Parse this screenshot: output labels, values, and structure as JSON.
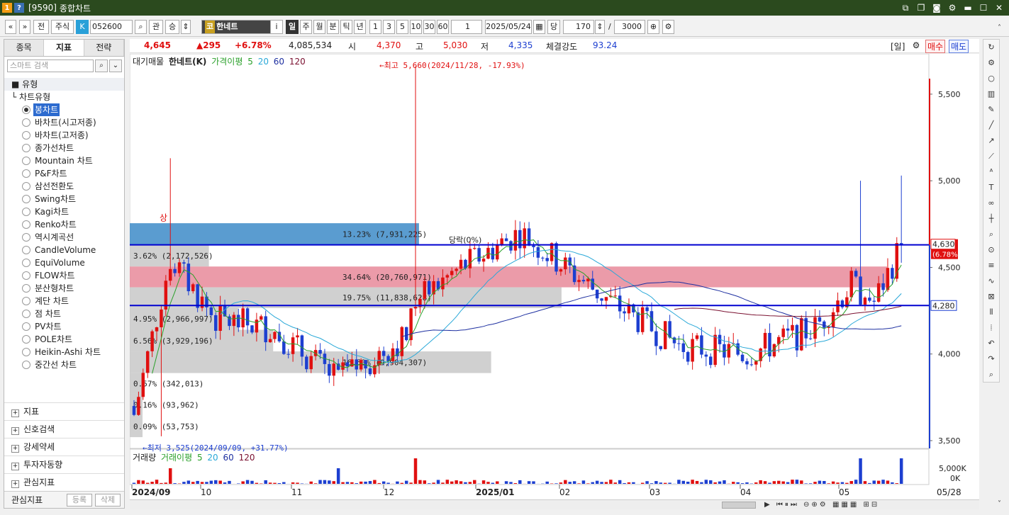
{
  "window": {
    "code": "[9590]",
    "title": "종합차트",
    "icons": [
      "help-icon",
      "menu-icon"
    ]
  },
  "toolbar": {
    "nav": [
      "«",
      "»"
    ],
    "jeon": "전",
    "market": "주식",
    "k_label": "K",
    "code": "052600",
    "gwan": "관",
    "seung": "승",
    "go_badge": "코",
    "stock_name": "한네트",
    "i_label": "i",
    "periods": [
      "일",
      "주",
      "월",
      "분",
      "틱",
      "년"
    ],
    "active_period": "일",
    "minutes": [
      "1",
      "3",
      "5",
      "10",
      "30",
      "60"
    ],
    "count": "1",
    "date": "2025/05/24",
    "dang": "당",
    "bars": "170",
    "slash": "/",
    "total": "3000"
  },
  "panel": {
    "tabs": [
      "종목",
      "지표",
      "전략"
    ],
    "active_tab": "지표",
    "search_placeholder": "스마트 검색",
    "category": "유형",
    "subcategory": "차트유형",
    "items": [
      "봉차트",
      "바차트(시고저종)",
      "바차트(고저종)",
      "종가선차트",
      "Mountain 차트",
      "P&F차트",
      "삼선전환도",
      "Swing차트",
      "Kagi차트",
      "Renko차트",
      "역시계곡선",
      "CandleVolume",
      "EquiVolume",
      "FLOW차트",
      "분산형차트",
      "계단 차트",
      "점 차트",
      "PV차트",
      "POLE차트",
      "Heikin-Ashi 차트",
      "중간선 차트"
    ],
    "selected_item": "봉차트",
    "groups": [
      "지표",
      "신호검색",
      "강세약세",
      "투자자동향",
      "관심지표"
    ],
    "footer_label": "관심지표",
    "register": "등록",
    "delete": "삭제"
  },
  "quote": {
    "price": "4,645",
    "change": "▲295",
    "rate": "+6.78%",
    "volume": "4,085,534",
    "open_label": "시",
    "open": "4,370",
    "high_label": "고",
    "high": "5,030",
    "low_label": "저",
    "low": "4,335",
    "strength_label": "체결강도",
    "strength": "93.24",
    "period_btn": "[일]",
    "buy": "매수",
    "sell": "매도"
  },
  "legend": {
    "chart_type": "대기매물",
    "name": "한네트(K)",
    "ma_label": "가격이평",
    "ma": [
      "5",
      "20",
      "60",
      "120"
    ],
    "vol_label": "거래량",
    "vol_ma_label": "거래이평"
  },
  "colors": {
    "up": "#e01010",
    "down": "#1d3fd0",
    "ma5": "#2aa02a",
    "ma20": "#29a8d8",
    "ma60": "#1d2fa0",
    "ma120": "#7a1030"
  },
  "chart_data": {
    "type": "candlestick",
    "y_ticks": [
      "5,500",
      "5,000",
      "4,500",
      "4,000",
      "3,500"
    ],
    "y_tick_values": [
      5500,
      5000,
      4500,
      4000,
      3500
    ],
    "ylim": [
      3455,
      5700
    ],
    "x_labels": [
      "2024/09",
      "10",
      "11",
      "12",
      "2025/01",
      "02",
      "03",
      "04",
      "05",
      "05/28"
    ],
    "current_price_label": "4,630",
    "current_rate_label": "(6.78%)",
    "hline_value": 4630,
    "hline2_value": 4280,
    "hline2_label": "4,280",
    "high_annotation": "←최고 5,660(2024/11/28, -17.93%)",
    "low_annotation": "←최저 3,525(2024/09/09, +31.77%)",
    "up_marker": "상",
    "volume_profile": [
      {
        "label": "13.23% (7,931,225)",
        "top": 4755,
        "bottom": 4630,
        "pct": 13.23,
        "color": "blue"
      },
      {
        "label": "3.62% (2,172,526)",
        "top": 4630,
        "bottom": 4505,
        "pct": 3.62,
        "color": "gray"
      },
      {
        "label": "34.64% (20,760,971)",
        "top": 4505,
        "bottom": 4385,
        "pct": 34.64,
        "color": "pink"
      },
      {
        "label": "19.75% (11,838,628)",
        "top": 4385,
        "bottom": 4265,
        "pct": 19.75,
        "color": "gray"
      },
      {
        "label": "4.95% (2,966,997)",
        "top": 4265,
        "bottom": 4140,
        "pct": 4.95,
        "color": "gray"
      },
      {
        "label": "6.56% (3,929,196)",
        "top": 4140,
        "bottom": 4015,
        "pct": 6.56,
        "color": "gray"
      },
      {
        "label": "16.53% (9,904,307)",
        "top": 4015,
        "bottom": 3890,
        "pct": 16.53,
        "color": "gray"
      },
      {
        "label": "0.57% (342,013)",
        "top": 3890,
        "bottom": 3770,
        "pct": 0.57,
        "color": "gray"
      },
      {
        "label": "0.16% (93,962)",
        "top": 3770,
        "bottom": 3645,
        "pct": 0.16,
        "color": "gray"
      },
      {
        "label": "0.09% (53,753)",
        "top": 3645,
        "bottom": 3520,
        "pct": 0.09,
        "color": "gray"
      }
    ],
    "boundary_label": "당락(0%)",
    "volume_ticks": [
      "5,000K",
      "0K"
    ]
  }
}
